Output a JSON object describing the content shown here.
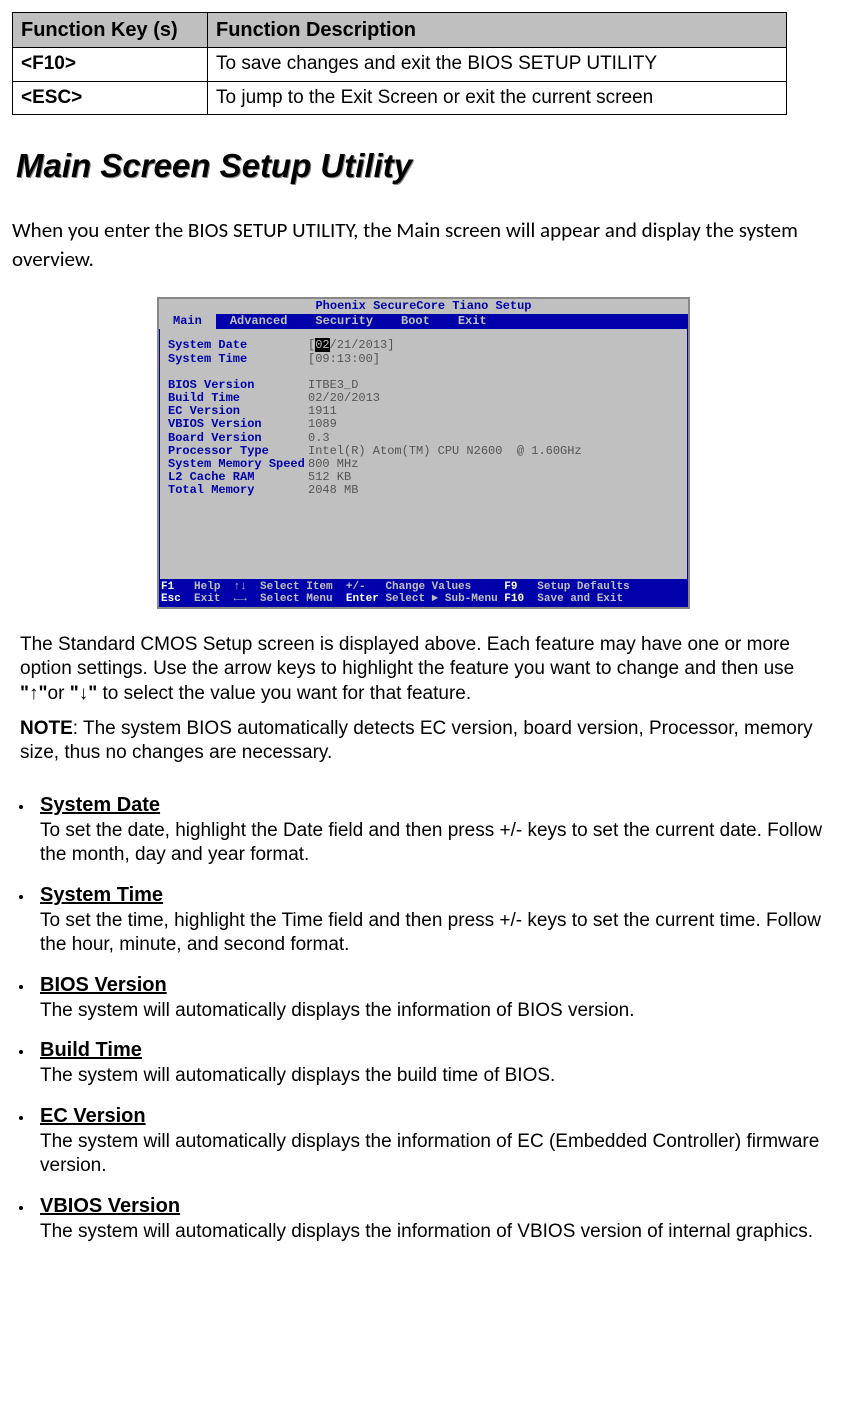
{
  "fk_table": {
    "headers": [
      "Function Key (s)",
      "Function Description"
    ],
    "rows": [
      {
        "key": "<F10>",
        "desc": "To save changes and exit the BIOS SETUP UTILITY"
      },
      {
        "key": "<ESC>",
        "desc": "To jump to the Exit Screen or exit the current screen"
      }
    ]
  },
  "section_title": "Main Screen Setup Utility",
  "intro": "When you enter the BIOS SETUP UTILITY, the Main screen will appear and display the system overview.",
  "bios": {
    "title": "Phoenix SecureCore Tiano Setup",
    "menu": [
      "Main",
      "Advanced",
      "Security",
      "Boot",
      "Exit"
    ],
    "menu_selected": 0,
    "rows": [
      {
        "label": "System Date",
        "value_pre": "[",
        "value_hl": "02",
        "value_post": "/21/2013]"
      },
      {
        "label": "System Time",
        "value": "[09:13:00]"
      },
      {
        "label": "",
        "value": ""
      },
      {
        "label": "BIOS Version",
        "value": "ITBE3_D"
      },
      {
        "label": "Build Time",
        "value": "02/20/2013"
      },
      {
        "label": "EC Version",
        "value": "1911"
      },
      {
        "label": "VBIOS Version",
        "value": "1089"
      },
      {
        "label": "Board Version",
        "value": "0.3"
      },
      {
        "label": "Processor Type",
        "value": "Intel(R) Atom(TM) CPU N2600  @ 1.60GHz"
      },
      {
        "label": "System Memory Speed",
        "value": "800 MHz"
      },
      {
        "label": "L2 Cache RAM",
        "value": "512 KB"
      },
      {
        "label": "Total Memory",
        "value": "2048 MB"
      }
    ],
    "footer_l1_a": "F1",
    "footer_l1_b": "Help  ↑↓  Select Item  +/-   Change Values     ",
    "footer_l1_c": "F9",
    "footer_l1_d": "   Setup Defaults",
    "footer_l2_a": "Esc",
    "footer_l2_b": "Exit  ←→  Select Menu  ",
    "footer_l2_c": "Enter",
    "footer_l2_d": " Select ► Sub-Menu ",
    "footer_l2_e": "F10",
    "footer_l2_f": "  Save and Exit"
  },
  "para1_pre": "The Standard CMOS Setup screen is displayed above. Each feature may have one or more option settings. Use the arrow keys to highlight the feature you want to change and then use ",
  "para1_up": "\"↑\"",
  "para1_mid": "or ",
  "para1_down": "\"↓\"",
  "para1_post": " to select the value you want for that feature.",
  "note_label": "NOTE",
  "note_text": ": The system BIOS automatically detects EC version, board version, Processor, memory size, thus no changes are necessary.",
  "fields": [
    {
      "title": "System Date",
      "desc": "To set the date, highlight the Date field and then press +/- keys to set the current date. Follow the month, day and year format."
    },
    {
      "title": "System Time",
      "desc": "To set the time, highlight the Time field and then press +/- keys to set the current time. Follow the hour, minute, and second format."
    },
    {
      "title": "BIOS Version",
      "desc": "The system will automatically displays the information of BIOS version."
    },
    {
      "title": "Build Time",
      "desc": "The system will automatically displays the build time of BIOS."
    },
    {
      "title": "EC Version",
      "desc": "The system will automatically displays the information of EC (Embedded Controller) firmware version."
    },
    {
      "title": "VBIOS Version",
      "desc": "The system will automatically displays the information of VBIOS version of internal graphics."
    }
  ]
}
